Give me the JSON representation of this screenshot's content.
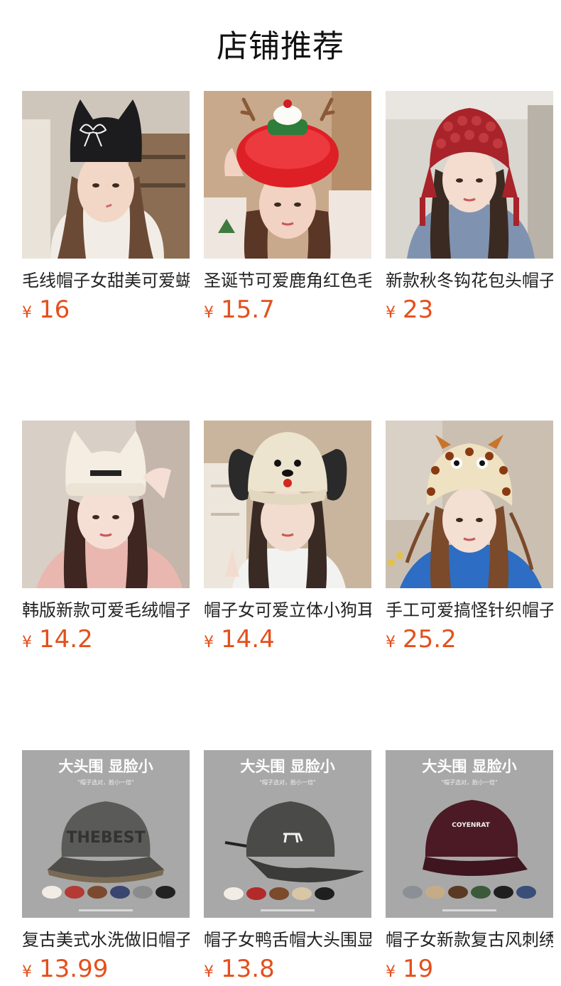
{
  "page_title": "店铺推荐",
  "colors": {
    "price": "#e4501c",
    "title": "#111111"
  },
  "currency_symbol": "¥",
  "products": [
    {
      "name": "毛线帽子女甜美可爱蝴蝶结猫耳朵",
      "price": "16",
      "image": "black-cat-ear-knit-beanie-photo"
    },
    {
      "name": "圣诞节可爱鹿角红色毛绒帽子",
      "price": "15.7",
      "image": "red-christmas-antler-fur-hat-photo"
    },
    {
      "name": "新款秋冬钩花包头帽子女",
      "price": "23",
      "image": "red-crochet-tassel-hat-photo"
    },
    {
      "name": "韩版新款可爱毛绒帽子女猫耳",
      "price": "14.2",
      "image": "cream-cat-ear-fuzzy-beanie-photo"
    },
    {
      "name": "帽子女可爱立体小狗耳朵棒球帽",
      "price": "14.4",
      "image": "puppy-ear-baseball-cap-photo"
    },
    {
      "name": "手工可爱搞怪针织帽子女",
      "price": "25.2",
      "image": "handmade-spiky-knit-hat-photo"
    },
    {
      "name": "复古美式水洗做旧帽子女",
      "price": "13.99",
      "image": "washed-vintage-baseball-cap-photo",
      "banner": "大头围 显脸小",
      "sub": "\"帽子选对，脸小一倍\"",
      "cap_text": "THEBEST"
    },
    {
      "name": "帽子女鸭舌帽大头围显脸小",
      "price": "13.8",
      "image": "black-duck-tongue-cap-photo",
      "banner": "大头围 显脸小",
      "sub": "\"帽子选对，脸小一倍\""
    },
    {
      "name": "帽子女新款复古风刺绣棒球帽",
      "price": "19",
      "image": "burgundy-embroidered-cap-photo",
      "banner": "大头围 显脸小",
      "sub": "\"帽子选对，脸小一倍\"",
      "cap_text": "COYENRAT"
    }
  ]
}
